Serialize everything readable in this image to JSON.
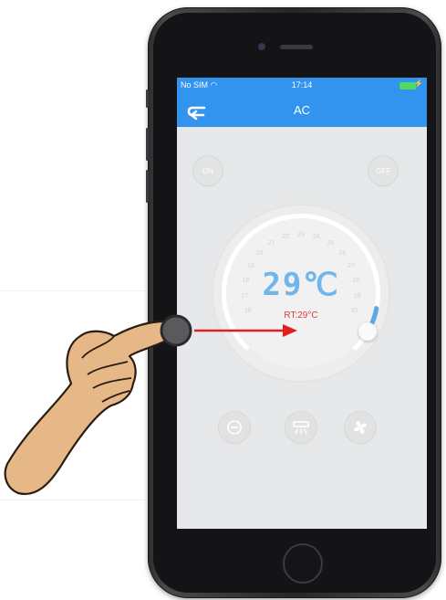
{
  "status_bar": {
    "carrier": "No SIM",
    "time": "17:14"
  },
  "nav": {
    "title": "AC"
  },
  "controls": {
    "on_label": "ON",
    "off_label": "OFF"
  },
  "dial": {
    "set_temp": "29℃",
    "room_temp": "RT:29°C",
    "scale": [
      "16",
      "17",
      "18",
      "19",
      "20",
      "21",
      "22",
      "23",
      "24",
      "25",
      "26",
      "27",
      "28",
      "29",
      "30"
    ],
    "current_value": 29,
    "min": 16,
    "max": 30
  },
  "bottom_buttons": [
    {
      "icon": "minus-icon"
    },
    {
      "icon": "swing-icon"
    },
    {
      "icon": "fan-icon"
    }
  ],
  "colors": {
    "header": "#3294ee",
    "temp_text": "#6fb6ec",
    "room_temp_text": "#e23a3a",
    "arrow": "#e02020",
    "finger": "#e6b887"
  }
}
